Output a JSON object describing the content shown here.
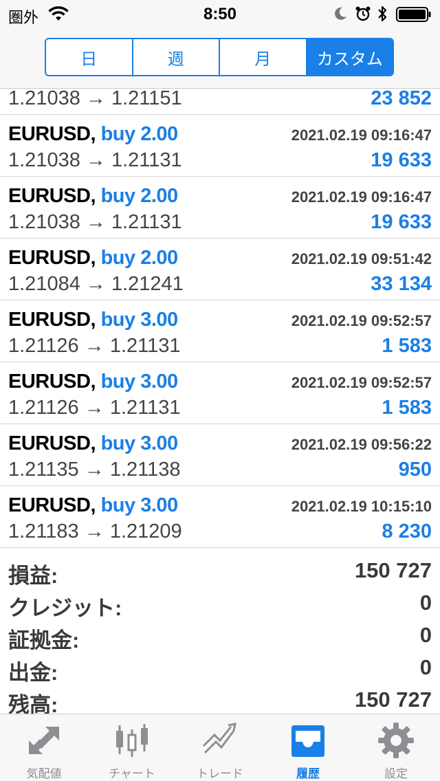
{
  "status_bar": {
    "carrier": "圏外",
    "time": "8:50"
  },
  "period_tabs": [
    {
      "label": "日",
      "active": false
    },
    {
      "label": "週",
      "active": false
    },
    {
      "label": "月",
      "active": false
    },
    {
      "label": "カスタム",
      "active": true
    }
  ],
  "deals": [
    {
      "symbol": "",
      "side": "",
      "time": "",
      "open_price": "1.21038",
      "close_price": "1.21151",
      "profit": "23 852",
      "arrow": "→"
    },
    {
      "symbol": "EURUSD,",
      "side": "buy 2.00",
      "time": "2021.02.19 09:16:47",
      "open_price": "1.21038",
      "close_price": "1.21131",
      "profit": "19 633",
      "arrow": "→"
    },
    {
      "symbol": "EURUSD,",
      "side": "buy 2.00",
      "time": "2021.02.19 09:16:47",
      "open_price": "1.21038",
      "close_price": "1.21131",
      "profit": "19 633",
      "arrow": "→"
    },
    {
      "symbol": "EURUSD,",
      "side": "buy 2.00",
      "time": "2021.02.19 09:51:42",
      "open_price": "1.21084",
      "close_price": "1.21241",
      "profit": "33 134",
      "arrow": "→"
    },
    {
      "symbol": "EURUSD,",
      "side": "buy 3.00",
      "time": "2021.02.19 09:52:57",
      "open_price": "1.21126",
      "close_price": "1.21131",
      "profit": "1 583",
      "arrow": "→"
    },
    {
      "symbol": "EURUSD,",
      "side": "buy 3.00",
      "time": "2021.02.19 09:52:57",
      "open_price": "1.21126",
      "close_price": "1.21131",
      "profit": "1 583",
      "arrow": "→"
    },
    {
      "symbol": "EURUSD,",
      "side": "buy 3.00",
      "time": "2021.02.19 09:56:22",
      "open_price": "1.21135",
      "close_price": "1.21138",
      "profit": "950",
      "arrow": "→"
    },
    {
      "symbol": "EURUSD,",
      "side": "buy 3.00",
      "time": "2021.02.19 10:15:10",
      "open_price": "1.21183",
      "close_price": "1.21209",
      "profit": "8 230",
      "arrow": "→"
    }
  ],
  "summary": [
    {
      "label": "損益:",
      "value": "150 727"
    },
    {
      "label": "クレジット:",
      "value": "0"
    },
    {
      "label": "証拠金:",
      "value": "0"
    },
    {
      "label": "出金:",
      "value": "0"
    },
    {
      "label": "残高:",
      "value": "150 727"
    }
  ],
  "tabbar": [
    {
      "label": "気配値",
      "icon": "quotes-arrows-icon",
      "active": false
    },
    {
      "label": "チャート",
      "icon": "candlestick-chart-icon",
      "active": false
    },
    {
      "label": "トレード",
      "icon": "trade-trend-icon",
      "active": false
    },
    {
      "label": "履歴",
      "icon": "history-inbox-icon",
      "active": true
    },
    {
      "label": "設定",
      "icon": "settings-gear-icon",
      "active": false
    }
  ],
  "colors": {
    "accent": "#1a7fe6",
    "bar_background": "#f7f7f7",
    "inactive_tab": "#8e8e93"
  }
}
